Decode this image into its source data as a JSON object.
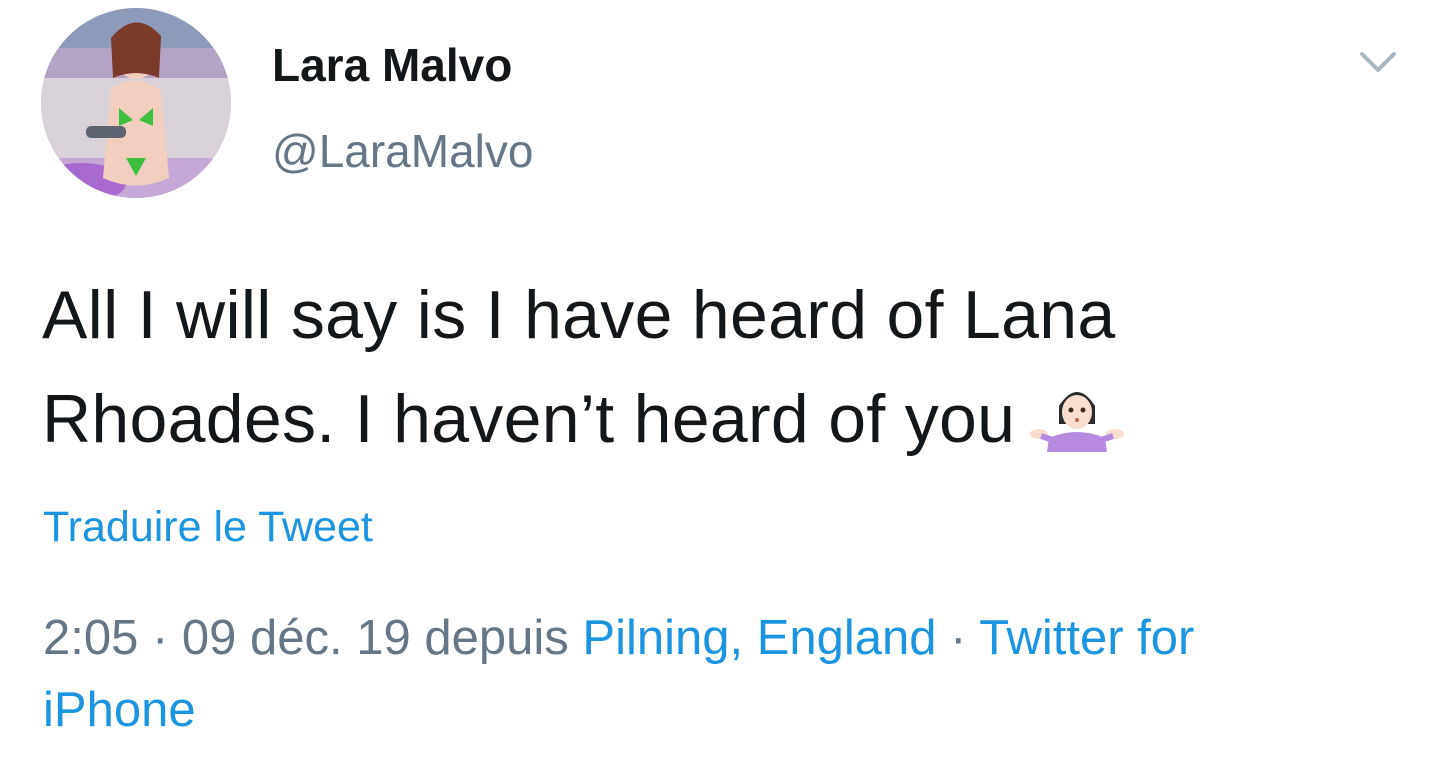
{
  "user": {
    "display_name": "Lara Malvo",
    "handle": "@LaraMalvo",
    "avatar_icon": "profile-photo"
  },
  "header": {
    "menu_icon": "chevron-down-icon"
  },
  "tweet": {
    "text_line_1": "All I will say is I have heard of Lana",
    "text_line_2": "Rhoades. I haven’t heard of you",
    "emoji": "woman-shrugging-emoji"
  },
  "translate_label": "Traduire le Tweet",
  "meta": {
    "time": "2:05",
    "separator_1": " · ",
    "date": "09 déc. 19",
    "from_word": " depuis ",
    "location": "Pilning, England",
    "separator_2": " · ",
    "source_part_1": "Twitter for",
    "source_part_2": "iPhone"
  },
  "colors": {
    "text": "#14171a",
    "secondary": "#657786",
    "link": "#1b95e0"
  }
}
